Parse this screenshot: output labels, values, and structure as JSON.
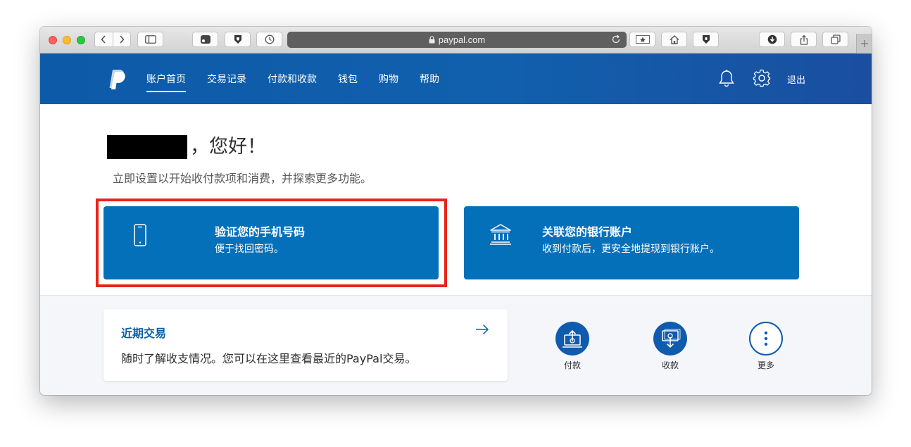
{
  "browser": {
    "url": "paypal.com"
  },
  "nav": {
    "items": [
      "账户首页",
      "交易记录",
      "付款和收款",
      "钱包",
      "购物",
      "帮助"
    ],
    "logout_label": "退出"
  },
  "greeting": {
    "text": "，您好！",
    "subtitle": "立即设置以开始收付款项和消费，并探索更多功能。"
  },
  "cards": {
    "phone": {
      "title": "验证您的手机号码",
      "description": "便于找回密码。"
    },
    "bank": {
      "title": "关联您的银行账户",
      "description": "收到付款后，更安全地提现到银行账户。"
    }
  },
  "recent": {
    "title": "近期交易",
    "description": "随时了解收支情况。您可以在这里查看最近的PayPal交易。"
  },
  "quick_actions": {
    "send": "付款",
    "receive": "收款",
    "more": "更多"
  },
  "colors": {
    "nav_blue": "#1160ad",
    "card_blue": "#0570ba",
    "highlight_red": "#e8241a"
  }
}
